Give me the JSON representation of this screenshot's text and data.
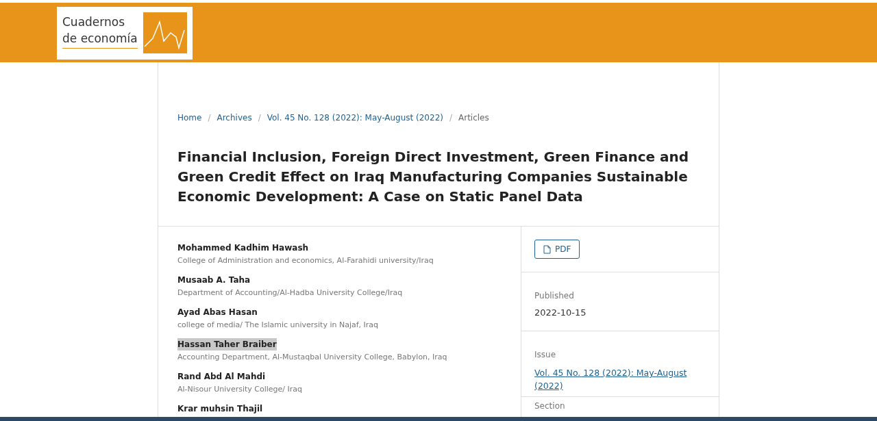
{
  "header": {
    "logo": {
      "line_1": "Cuadernos",
      "line_2": "de economía"
    }
  },
  "breadcrumb": [
    {
      "label": "Home",
      "link": true
    },
    {
      "separator": "/",
      "label": "Archives",
      "link": true
    },
    {
      "separator": "/",
      "label": "Vol. 45 No. 128 (2022): May-August (2022)",
      "link": true
    },
    {
      "separator": "/",
      "label": "Articles",
      "link": false
    }
  ],
  "title": "Financial Inclusion, Foreign Direct Investment, Green Finance and Green Credit Effect on Iraq Manufacturing Companies Sustainable Economic Development: A Case on Static Panel Data",
  "authors": [
    {
      "name": "Mohammed Kadhim Hawash",
      "affiliation": "College of Administration and economics, Al-Farahidi university/Iraq",
      "highlighted": false
    },
    {
      "name": "Musaab A. Taha",
      "affiliation": "Department of Accounting/Al-Hadba University College/Iraq",
      "highlighted": false
    },
    {
      "name": "Ayad Abas Hasan",
      "affiliation": "college of media/ The Islamic university in Najaf, Iraq",
      "highlighted": false
    },
    {
      "name": "Hassan Taher Braiber",
      "affiliation": "Accounting Department, Al-Mustaqbal University College, Babylon, Iraq",
      "highlighted": true
    },
    {
      "name": "Rand Abd Al Mahdi",
      "affiliation": "Al-Nisour University College/ Iraq",
      "highlighted": false
    },
    {
      "name": "Krar muhsin Thajil",
      "highlighted": false
    }
  ],
  "galley": {
    "label": "PDF"
  },
  "published": {
    "label": "Published",
    "value": "2022-10-15"
  },
  "issue": {
    "label": "Issue",
    "value": "Vol. 45 No. 128 (2022): May-August (2022)"
  },
  "section": {
    "label": "Section"
  }
}
